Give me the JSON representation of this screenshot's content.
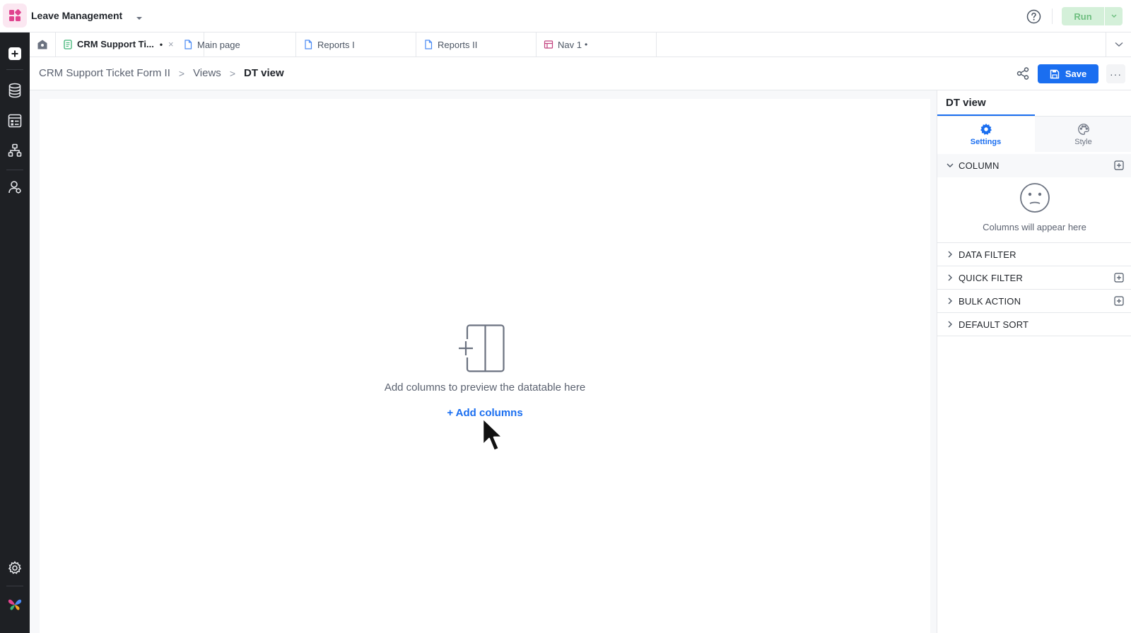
{
  "app": {
    "name": "Leave Management"
  },
  "topbar": {
    "run_label": "Run"
  },
  "tabs": [
    {
      "label": "CRM Support Ti...",
      "dot": "•",
      "close": "×",
      "icon": "form-icon",
      "active": true
    },
    {
      "label": "Main page",
      "icon": "page-icon"
    },
    {
      "label": "Reports I",
      "icon": "page-icon"
    },
    {
      "label": "Reports II",
      "icon": "page-icon"
    },
    {
      "label": "Nav 1",
      "dot": "•",
      "icon": "nav-icon"
    }
  ],
  "breadcrumb": {
    "items": [
      "CRM Support Ticket Form II",
      "Views",
      "DT view"
    ],
    "separator": ">"
  },
  "toolbar": {
    "save_label": "Save",
    "more_label": "···"
  },
  "canvas": {
    "empty_message": "Add columns to preview the datatable here",
    "add_columns_label": "+ Add columns"
  },
  "panel": {
    "title": "DT view",
    "tabs": {
      "settings": "Settings",
      "style": "Style"
    },
    "sections": {
      "column": "COLUMN",
      "data_filter": "DATA FILTER",
      "quick_filter": "QUICK FILTER",
      "bulk_action": "BULK ACTION",
      "default_sort": "DEFAULT SORT"
    },
    "column_empty": "Columns will appear here"
  },
  "colors": {
    "accent": "#1a6ef0",
    "rail": "#1e2024",
    "run_bg": "#d4f0d9",
    "run_text": "#6fbf80"
  }
}
